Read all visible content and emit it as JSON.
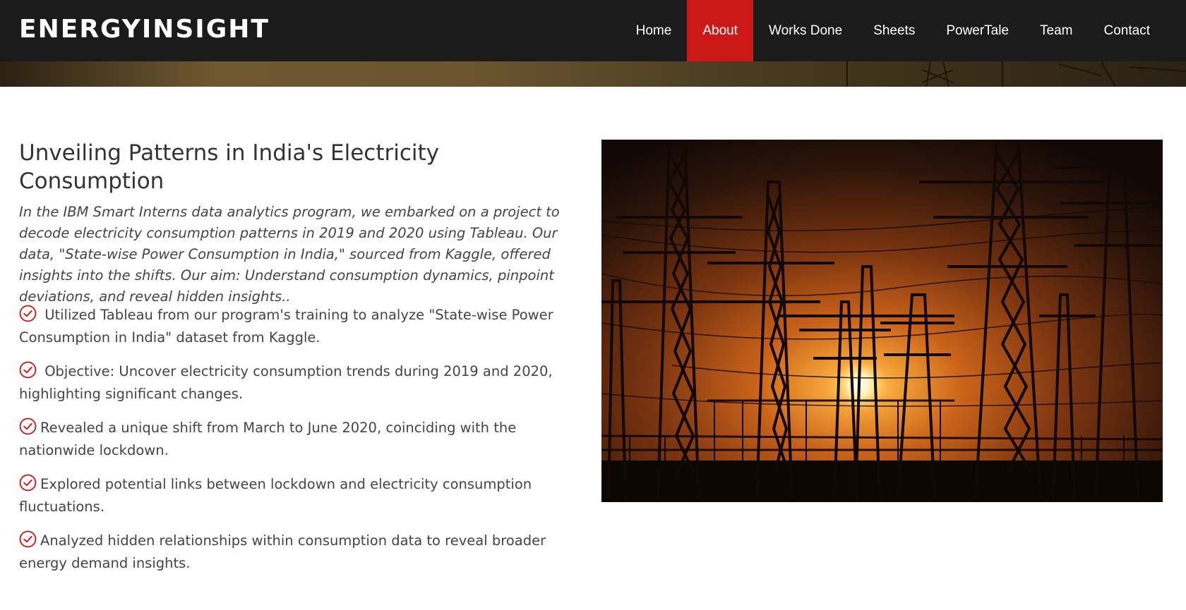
{
  "header": {
    "logo": "ENERGYINSIGHT",
    "nav": [
      {
        "label": "Home",
        "active": false
      },
      {
        "label": "About",
        "active": true
      },
      {
        "label": "Works Done",
        "active": false
      },
      {
        "label": "Sheets",
        "active": false
      },
      {
        "label": "PowerTale",
        "active": false
      },
      {
        "label": "Team",
        "active": false
      },
      {
        "label": "Contact",
        "active": false
      }
    ]
  },
  "about": {
    "title": "Unveiling Patterns in India's Electricity Consumption",
    "intro": "In the IBM Smart Interns data analytics program, we embarked on a project to decode electricity consumption patterns in 2019 and 2020 using Tableau. Our data, \"State-wise Power Consumption in India,\" sourced from Kaggle, offered insights into the shifts. Our aim: Understand consumption dynamics, pinpoint deviations, and reveal hidden insights..",
    "bullets": [
      " Utilized Tableau from our program's training to analyze \"State-wise Power Consumption in India\" dataset from Kaggle.",
      " Objective: Uncover electricity consumption trends during 2019 and 2020, highlighting significant changes.",
      "Revealed a unique shift from March to June 2020, coinciding with the nationwide lockdown.",
      "Explored potential links between lockdown and electricity consumption fluctuations.",
      "Analyzed hidden relationships within consumption data to reveal broader energy demand insights."
    ],
    "bullet_icon": "check-circle-icon",
    "image_icon": "power-towers-sunset-photo"
  },
  "colors": {
    "navbar_bg": "#1b1b1b",
    "accent": "#cd1818",
    "text": "#444444"
  }
}
